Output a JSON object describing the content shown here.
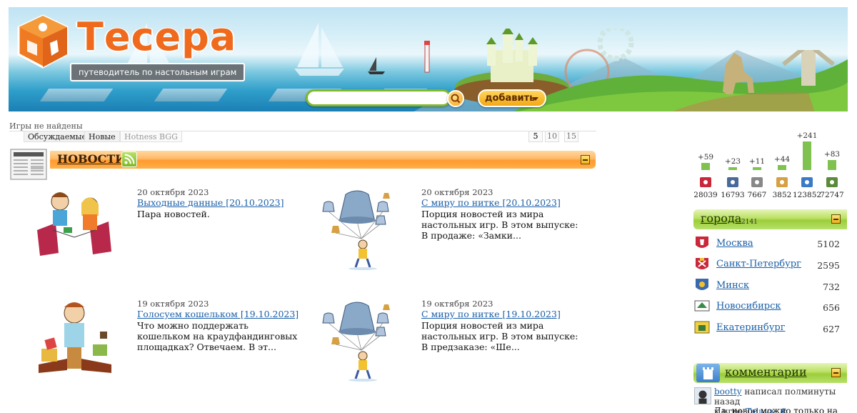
{
  "header": {
    "logo_title": "Тесера",
    "logo_tagline": "путеводитель по настольным играм",
    "search": {
      "value": "",
      "placeholder": ""
    },
    "add_label": "добавить"
  },
  "games_filter": {
    "status": "Игры не найдены",
    "tabs": [
      "Обсуждаемые",
      "Новые",
      "Hotness BGG"
    ],
    "page_sizes": [
      "5",
      "10",
      "15"
    ],
    "selected_page_size": "5"
  },
  "news": {
    "title": "НОВОСТИ",
    "items": [
      {
        "date": "20 октября 2023",
        "title": "Выходные данные [20.10.2023]",
        "text": [
          "Пара новостей."
        ]
      },
      {
        "date": "20 октября 2023",
        "title": "С миру по нитке [20.10.2023]",
        "text": [
          "Порция новостей из мира",
          "настольных игр.   В этом выпуске:",
          "В продаже: «Замки..."
        ]
      },
      {
        "date": "19 октября 2023",
        "title": "Голосуем кошельком [19.10.2023]",
        "text": [
          "Что можно поддержать",
          "кошельком на краудфандинговых",
          "площадках? Отвечаем.   В эт..."
        ]
      },
      {
        "date": "19 октября 2023",
        "title": "С миру по нитке [19.10.2023]",
        "text": [
          "Порция новостей из мира",
          "настольных игр.   В этом выпуске:",
          "В предзаказе: «Ше..."
        ]
      }
    ]
  },
  "stats": [
    {
      "icon": "dice-icon",
      "delta": "+59",
      "total": "28039",
      "level": 59
    },
    {
      "icon": "person-card-icon",
      "delta": "+23",
      "total": "16793",
      "level": 23
    },
    {
      "icon": "newspaper-icon",
      "delta": "+11",
      "total": "7667",
      "level": 11
    },
    {
      "icon": "scroll-icon",
      "delta": "+44",
      "total": "3852",
      "level": 44
    },
    {
      "icon": "comments-icon",
      "delta": "+241",
      "total": "123852",
      "level": 241
    },
    {
      "icon": "user-icon",
      "delta": "+83",
      "total": "72747",
      "level": 83
    }
  ],
  "cities": {
    "title": "города",
    "count": "2141",
    "items": [
      {
        "name": "Москва",
        "count": "5102"
      },
      {
        "name": "Санкт-Петербург",
        "count": "2595"
      },
      {
        "name": "Минск",
        "count": "732"
      },
      {
        "name": "Новосибирск",
        "count": "656"
      },
      {
        "name": "Екатеринбург",
        "count": "627"
      }
    ]
  },
  "comments": {
    "title": "комментарии",
    "first": {
      "user": "bootty",
      "action": "написал полминуты назад",
      "prefix": "к игре",
      "game": "Taluva",
      "link": "#",
      "snippet": "Да, новое можно только на"
    }
  },
  "colors": {
    "brand_orange": "#ef6a1c",
    "news_bar": "#ff9a2e",
    "green_bar": "#9ccd3a",
    "link": "#1a5fa8",
    "stat_bar": "#7fc24f"
  }
}
